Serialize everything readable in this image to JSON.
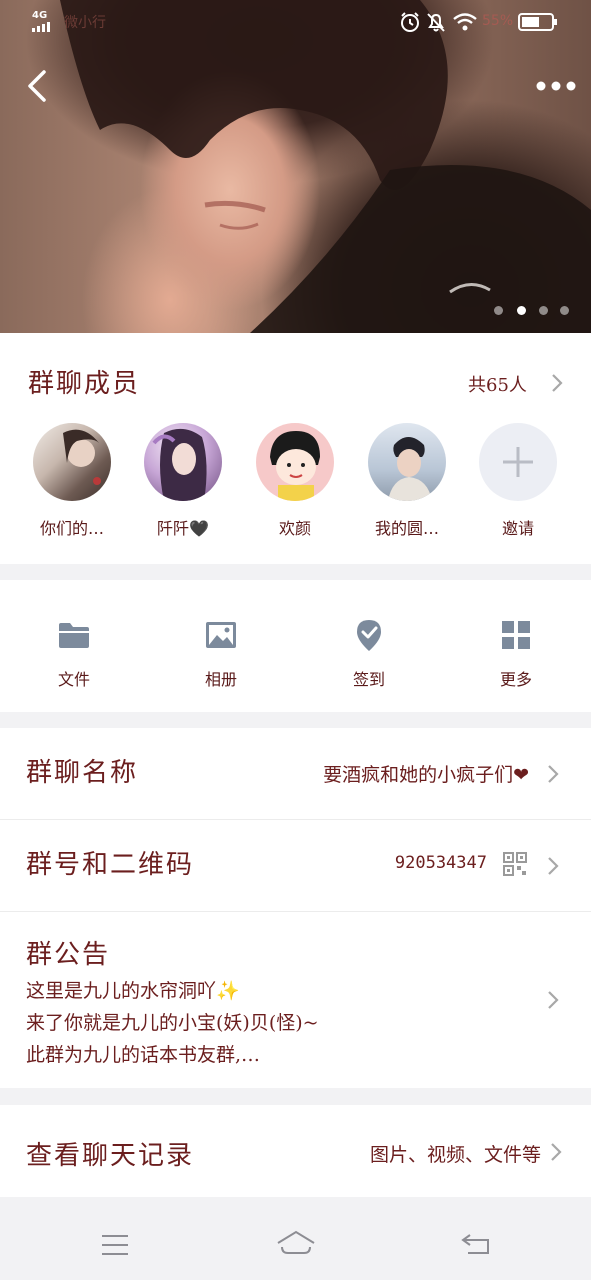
{
  "status_bar": {
    "network": "4G",
    "carrier": "微小行",
    "battery_percent": "55%"
  },
  "header": {
    "carousel_total": 4,
    "carousel_active": 2
  },
  "members": {
    "title": "群聊成员",
    "count": "共65人",
    "items": [
      {
        "name": "你们的…"
      },
      {
        "name": "阡阡🖤"
      },
      {
        "name": "欢颜"
      },
      {
        "name": "我的圆…"
      },
      {
        "name": "邀请"
      }
    ]
  },
  "tools": [
    {
      "label": "文件",
      "icon": "folder-icon"
    },
    {
      "label": "相册",
      "icon": "image-icon"
    },
    {
      "label": "签到",
      "icon": "checkin-icon"
    },
    {
      "label": "更多",
      "icon": "grid-icon"
    }
  ],
  "group_name": {
    "label": "群聊名称",
    "value": "要酒疯和她的小疯子们❤"
  },
  "group_id": {
    "label": "群号和二维码",
    "value": "920534347"
  },
  "notice": {
    "label": "群公告",
    "lines": [
      "这里是九儿的水帘洞吖✨",
      "来了你就是九儿的小宝(妖)贝(怪)~",
      "此群为九儿的话本书友群,…"
    ]
  },
  "history": {
    "label": "查看聊天记录",
    "value": "图片、视频、文件等"
  },
  "colors": {
    "accent_text": "#6b1e1e",
    "icon_gray": "#7c8a9c",
    "divider": "#ececec"
  }
}
